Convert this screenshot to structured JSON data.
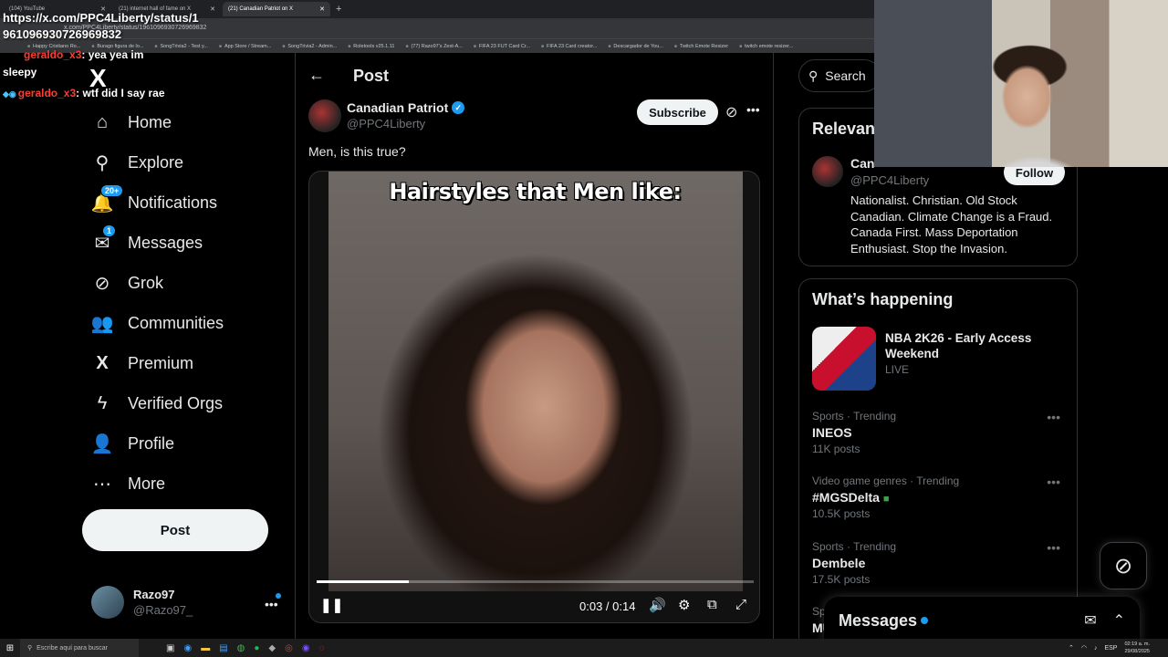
{
  "browser": {
    "tabs": [
      {
        "label": "(104) YouTube",
        "active": false
      },
      {
        "label": "(21) internet hall of fame on X",
        "active": false
      },
      {
        "label": "(21) Canadian Patriot on X",
        "active": true
      }
    ],
    "url": "x.com/PPC4Liberty/status/1961096930726969832",
    "bookmarks": [
      "Happy Cristiano Ro...",
      "Burago figura de lo...",
      "SongTrivia2 - Test y...",
      "App Store / Stream...",
      "SongTrivia2 - Admin...",
      "Roletools v25.1.11",
      "(77) Razo97's Zest-A...",
      "FIFA 23 FUT Card Cr...",
      "FIFA 23 Card creator...",
      "Descargador de You...",
      "Twitch Emote Resizer",
      "twitch emote resizer..."
    ]
  },
  "overlay": {
    "link_line1": "https://x.com/PPC4Liberty/status/1",
    "link_line2": "961096930726969832",
    "chat": [
      {
        "user": "",
        "message": "sleepy"
      },
      {
        "user": "geraldo_x3",
        "message": ": yea yea im"
      },
      {
        "user": "geraldo_x3",
        "message": ": wtf did I say rae"
      }
    ]
  },
  "sidebar": {
    "logo": "X",
    "items": [
      {
        "label": "Home",
        "icon": "home-icon",
        "glyph": "⌂",
        "badge": ""
      },
      {
        "label": "Explore",
        "icon": "search-icon",
        "glyph": "⚲",
        "badge": ""
      },
      {
        "label": "Notifications",
        "icon": "bell-icon",
        "glyph": "🔔",
        "badge": "20+"
      },
      {
        "label": "Messages",
        "icon": "mail-icon",
        "glyph": "✉",
        "badge": "1"
      },
      {
        "label": "Grok",
        "icon": "grok-icon",
        "glyph": "⊘",
        "badge": ""
      },
      {
        "label": "Communities",
        "icon": "communities-icon",
        "glyph": "👥",
        "badge": ""
      },
      {
        "label": "Premium",
        "icon": "x-icon",
        "glyph": "X",
        "badge": ""
      },
      {
        "label": "Verified Orgs",
        "icon": "lightning-icon",
        "glyph": "ϟ",
        "badge": ""
      },
      {
        "label": "Profile",
        "icon": "person-icon",
        "glyph": "👤",
        "badge": ""
      },
      {
        "label": "More",
        "icon": "more-circle-icon",
        "glyph": "⋯",
        "badge": ""
      }
    ],
    "post_button": "Post",
    "account": {
      "name": "Razo97",
      "handle": "@Razo97_"
    }
  },
  "main": {
    "header_title": "Post",
    "author": {
      "name": "Canadian Patriot",
      "handle": "@PPC4Liberty"
    },
    "subscribe_label": "Subscribe",
    "text": "Men, is this true?",
    "video": {
      "caption": "Hairstyles that Men like:",
      "current_time": "0:03",
      "duration": "0:14",
      "time_display": "0:03 / 0:14",
      "progress_fraction": 0.21
    }
  },
  "right": {
    "search_label": "Search",
    "relevant": {
      "title": "Relevan",
      "name": "Can",
      "handle": "@PPC4Liberty",
      "follow_label": "Follow",
      "bio": "Nationalist. Christian. Old Stock Canadian. Climate Change is a Fraud. Canada First. Mass Deportation Enthusiast. Stop the Invasion."
    },
    "happening": {
      "title": "What’s happening",
      "featured": {
        "title": "NBA 2K26 - Early Access Weekend",
        "status": "LIVE"
      },
      "trends": [
        {
          "context": "Sports · Trending",
          "name": "INEOS",
          "count": "11K posts"
        },
        {
          "context": "Video game genres · Trending",
          "name": "#MGSDelta",
          "count": "10.5K posts"
        },
        {
          "context": "Sports · Trending",
          "name": "Dembele",
          "count": "17.5K posts"
        },
        {
          "context": "Spo",
          "name": "MU",
          "count": ""
        }
      ]
    },
    "messages_drawer": "Messages"
  },
  "taskbar": {
    "search_placeholder": "Escribe aquí para buscar",
    "language": "ESP",
    "time": "02:19 a. m.",
    "date": "29/08/2025"
  },
  "colors": {
    "accent": "#1d9bf0",
    "background": "#000000",
    "border": "#2f3336",
    "text": "#e7e9ea",
    "muted": "#71767b"
  }
}
